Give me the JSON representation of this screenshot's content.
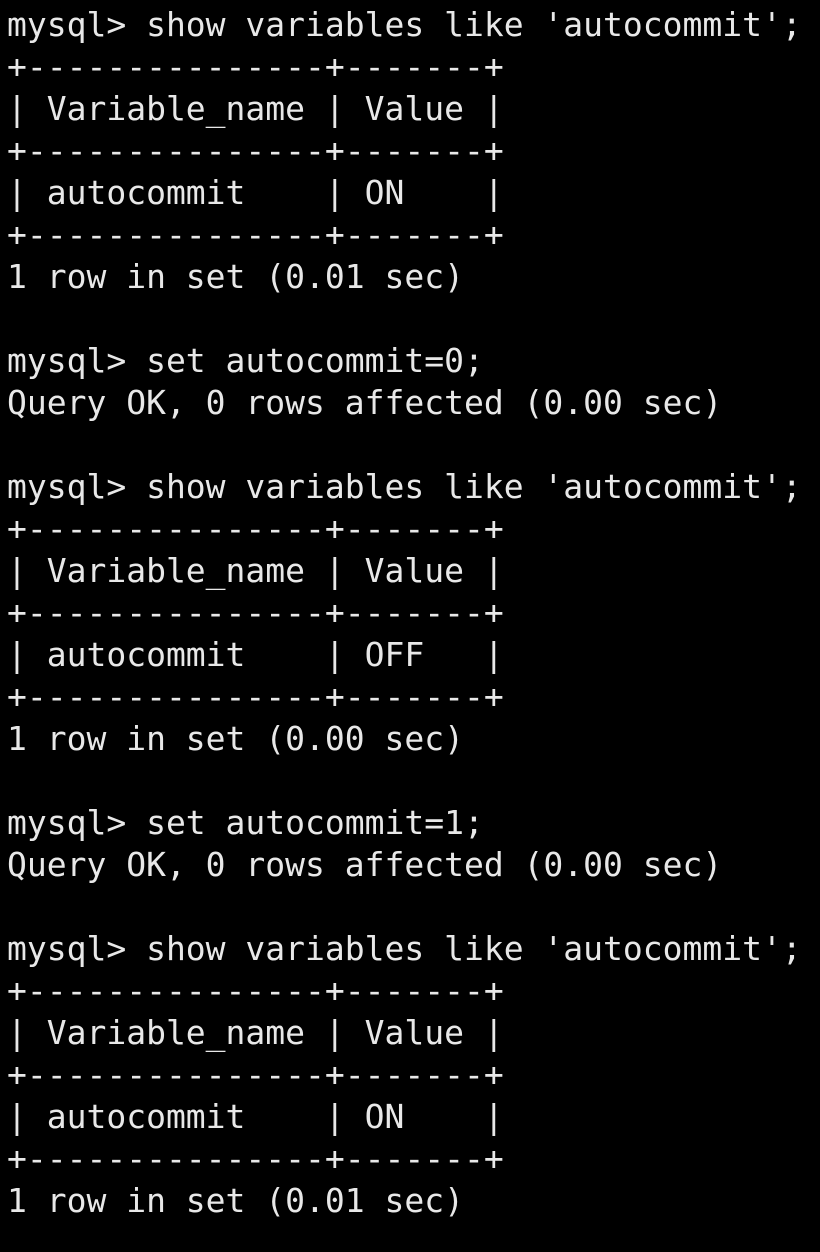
{
  "terminal": {
    "lines": [
      "mysql> show variables like 'autocommit';",
      "+---------------+-------+",
      "| Variable_name | Value |",
      "+---------------+-------+",
      "| autocommit    | ON    |",
      "+---------------+-------+",
      "1 row in set (0.01 sec)",
      "",
      "mysql> set autocommit=0;",
      "Query OK, 0 rows affected (0.00 sec)",
      "",
      "mysql> show variables like 'autocommit';",
      "+---------------+-------+",
      "| Variable_name | Value |",
      "+---------------+-------+",
      "| autocommit    | OFF   |",
      "+---------------+-------+",
      "1 row in set (0.00 sec)",
      "",
      "mysql> set autocommit=1;",
      "Query OK, 0 rows affected (0.00 sec)",
      "",
      "mysql> show variables like 'autocommit';",
      "+---------------+-------+",
      "| Variable_name | Value |",
      "+---------------+-------+",
      "| autocommit    | ON    |",
      "+---------------+-------+",
      "1 row in set (0.01 sec)"
    ]
  }
}
